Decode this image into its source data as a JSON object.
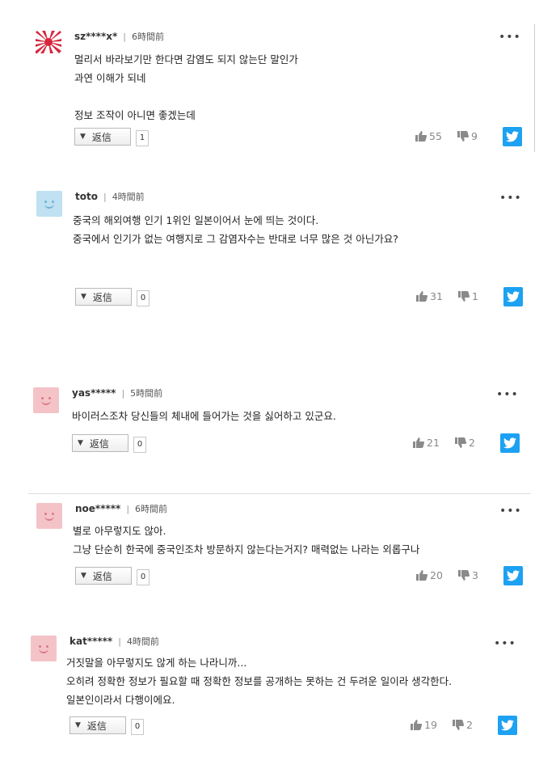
{
  "comments": [
    {
      "user": "sz****x*",
      "time": "6時間前",
      "avatar": "rising-sun-flag",
      "lines": [
        "멀리서 바라보기만 한다면 감염도 되지 않는단 말인가",
        "과연 이해가 되네",
        "",
        "정보 조작이 아니면 좋겠는데"
      ],
      "reply_label": "返信",
      "reply_count": "1",
      "likes": "55",
      "dislikes": "9"
    },
    {
      "user": "toto",
      "time": "4時間前",
      "avatar": "blue-face",
      "lines": [
        "중국의 해외여행 인기 1위인 일본이어서 눈에 띄는 것이다.",
        "중국에서 인기가 없는 여행지로 그 감염자수는 반대로 너무 많은 것 아닌가요?"
      ],
      "reply_label": "返信",
      "reply_count": "0",
      "likes": "31",
      "dislikes": "1"
    },
    {
      "user": "yas*****",
      "time": "5時間前",
      "avatar": "pink-face",
      "lines": [
        "바이러스조차 당신들의 체내에 들어가는 것을 싫어하고 있군요."
      ],
      "reply_label": "返信",
      "reply_count": "0",
      "likes": "21",
      "dislikes": "2"
    },
    {
      "user": "noe*****",
      "time": "6時間前",
      "avatar": "pink-face",
      "lines": [
        "별로 아무렇지도 않아.",
        "그냥 단순히 한국에 중국인조차 방문하지 않는다는거지? 매력없는 나라는 외롭구나"
      ],
      "reply_label": "返信",
      "reply_count": "0",
      "likes": "20",
      "dislikes": "3"
    },
    {
      "user": "kat*****",
      "time": "4時間前",
      "avatar": "pink-face",
      "lines": [
        "거짓말을 아무렇지도 않게 하는 나라니까...",
        "오히려 정확한 정보가 필요할 때 정확한 정보를 공개하는 못하는 건 두려운 일이라 생각한다.",
        "일본인이라서 다행이에요."
      ],
      "reply_label": "返信",
      "reply_count": "0",
      "likes": "19",
      "dislikes": "2"
    }
  ],
  "more_glyph": "•••",
  "colors": {
    "twitter": "#1da1f2",
    "avatar_pink": "#f4c3c8",
    "avatar_blue": "#bfe1f2",
    "flag_red": "#d7263d"
  }
}
